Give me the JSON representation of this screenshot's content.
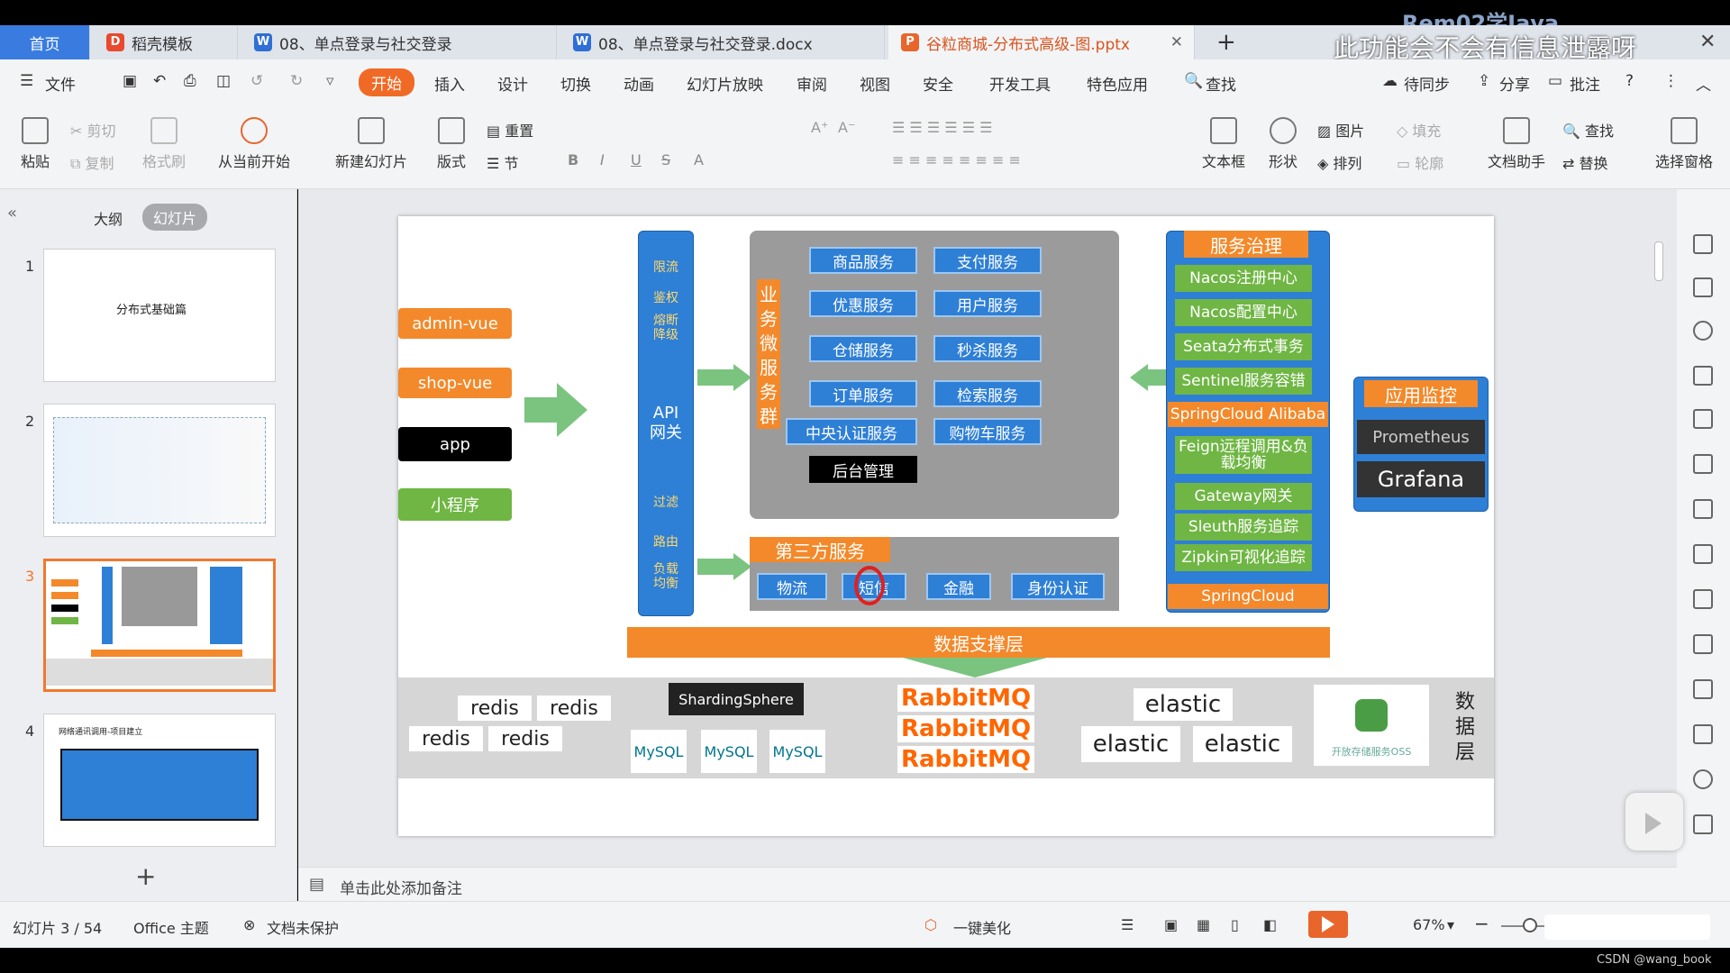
{
  "window": {
    "watermark": "Rem02学Java",
    "notice": "此功能会不会有信息泄露呀",
    "close": "✕"
  },
  "tabs": [
    {
      "label": "首页"
    },
    {
      "label": "稻壳模板"
    },
    {
      "label": "08、单点登录与社交登录"
    },
    {
      "label": "08、单点登录与社交登录.docx"
    },
    {
      "label": "谷粒商城-分布式高级-图.pptx"
    },
    {
      "label": "+"
    }
  ],
  "menu": {
    "file": "文件",
    "items": [
      "开始",
      "插入",
      "设计",
      "切换",
      "动画",
      "幻灯片放映",
      "审阅",
      "视图",
      "安全",
      "开发工具",
      "特色应用"
    ],
    "search": "查找",
    "sync": "待同步",
    "share": "分享",
    "comment": "批注"
  },
  "ribbon": {
    "paste": "粘贴",
    "cut": "剪切",
    "copy": "复制",
    "format_painter": "格式刷",
    "play_from_current": "从当前开始",
    "new_slide": "新建幻灯片",
    "layout": "版式",
    "reset": "重置",
    "section": "节",
    "font_size": "0",
    "textbox": "文本框",
    "shape": "形状",
    "picture": "图片",
    "arrange": "排列",
    "fill": "填充",
    "outline": "轮廓",
    "doc_assistant": "文档助手",
    "find": "查找",
    "replace": "替换",
    "select_pane": "选择窗格"
  },
  "leftpanel": {
    "outline_tab": "大纲",
    "slides_tab": "幻灯片",
    "thumb1_title": "分布式基础篇",
    "thumb4_title": "网络通讯调用-项目建立",
    "add": "+"
  },
  "slide": {
    "clients": [
      "admin-vue",
      "shop-vue",
      "app",
      "小程序"
    ],
    "gateway": {
      "top": [
        "限流",
        "鉴权",
        "熔断降级"
      ],
      "name": "API网关",
      "bottom": [
        "过滤",
        "路由",
        "负载均衡"
      ]
    },
    "micro_label": "业务微服务群",
    "services": [
      "商品服务",
      "支付服务",
      "优惠服务",
      "用户服务",
      "仓储服务",
      "秒杀服务",
      "订单服务",
      "检索服务",
      "中央认证服务",
      "购物车服务"
    ],
    "admin": "后台管理",
    "third_party": {
      "title": "第三方服务",
      "items": [
        "物流",
        "短信",
        "金融",
        "身份认证"
      ]
    },
    "governance": {
      "title": "服务治理",
      "alibaba_items": [
        "Nacos注册中心",
        "Nacos配置中心",
        "Seata分布式事务",
        "Sentinel服务容错"
      ],
      "alibaba": "SpringCloud Alibaba",
      "cloud_items": [
        "Feign远程调用&负载均衡",
        "Gateway网关",
        "Sleuth服务追踪",
        "Zipkin可视化追踪"
      ],
      "cloud": "SpringCloud"
    },
    "monitor": {
      "title": "应用监控",
      "items": [
        "Prometheus",
        "Grafana"
      ]
    },
    "data_support": "数据支撑层",
    "data_layer": "数据层",
    "logos": {
      "redis": "redis",
      "sharding": "ShardingSphere",
      "mysql": "MySQL",
      "rabbit": "RabbitMQ",
      "elastic": "elastic",
      "oss": "开放存储服务OSS"
    }
  },
  "notes": "单击此处添加备注",
  "status": {
    "slide_count": "幻灯片 3 / 54",
    "theme": "Office 主题",
    "protect": "文档未保护",
    "beautify": "一键美化",
    "zoom": "67%",
    "csdn": "CSDN @wang_book"
  }
}
